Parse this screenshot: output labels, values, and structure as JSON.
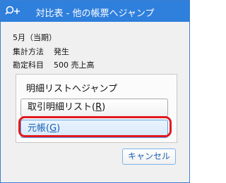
{
  "window": {
    "title": "対比表 - 他の帳票へジャンプ",
    "title_icon": "jump-search-icon",
    "accent_color": "#2f7fdc",
    "highlight_color": "#e2181f"
  },
  "info": {
    "period": "5月（当期）",
    "method_label": "集計方法",
    "method_value": "発生",
    "account_label": "勘定科目",
    "account_value": "500 売上高"
  },
  "jump_group": {
    "title": "明細リストへジャンプ",
    "list_button_text": "取引明細リスト(",
    "list_button_key": "R",
    "list_button_close": ")",
    "ledger_button_text": "元帳(",
    "ledger_button_key": "G",
    "ledger_button_close": ")"
  },
  "footer": {
    "cancel_label": "キャンセル"
  }
}
